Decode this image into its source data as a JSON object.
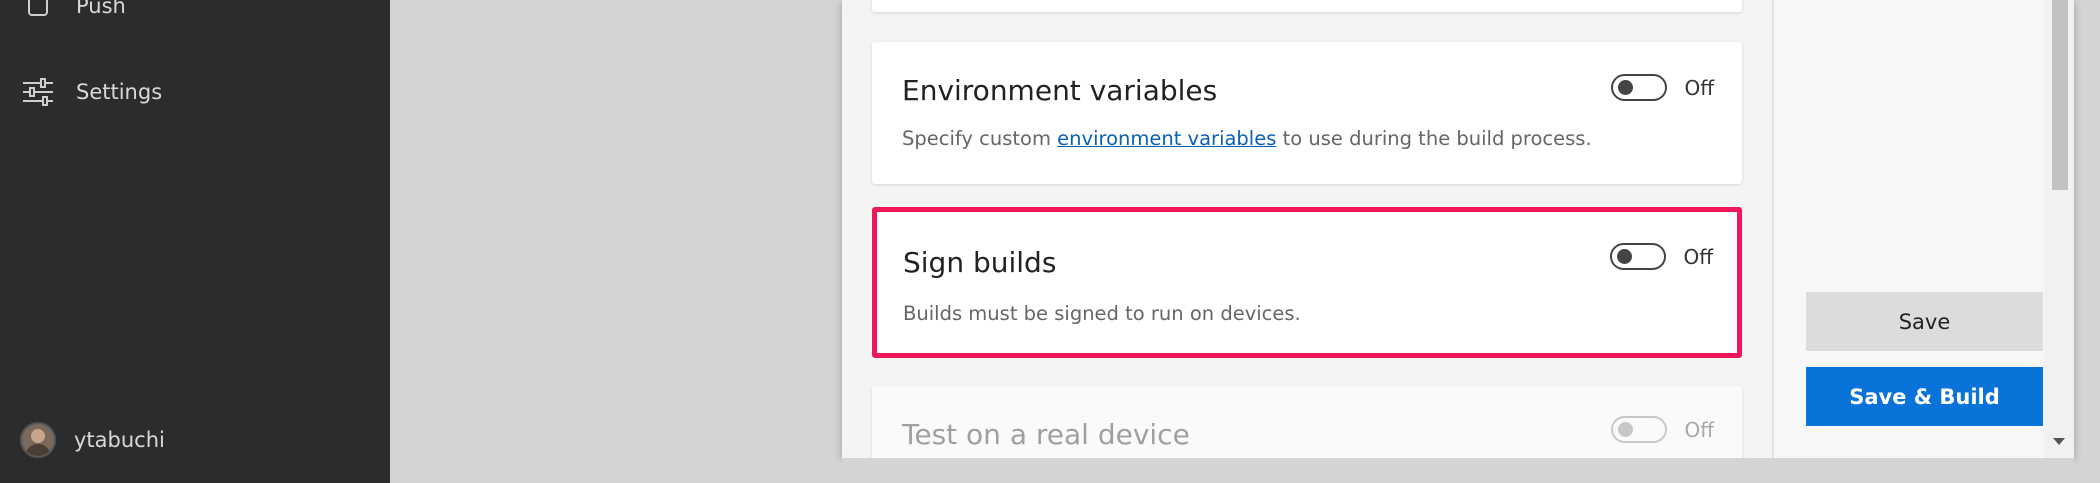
{
  "sidebar": {
    "items": [
      {
        "label": "Push",
        "icon": "square-icon"
      },
      {
        "label": "Settings",
        "icon": "sliders-icon"
      }
    ],
    "user": {
      "name": "ytabuchi"
    }
  },
  "settings": {
    "environment_variables": {
      "title": "Environment variables",
      "desc_prefix": "Specify custom ",
      "desc_link": "environment variables",
      "desc_suffix": " to use during the build process.",
      "toggle_label": "Off",
      "enabled": false
    },
    "sign_builds": {
      "title": "Sign builds",
      "description": "Builds must be signed to run on devices.",
      "toggle_label": "Off",
      "enabled": false,
      "highlight_color": "#f0165a"
    },
    "test_device": {
      "title": "Test on a real device",
      "toggle_label": "Off",
      "enabled": false,
      "disabled": true
    }
  },
  "actions": {
    "save_label": "Save",
    "save_build_label": "Save & Build",
    "primary_color": "#0a73d9"
  }
}
